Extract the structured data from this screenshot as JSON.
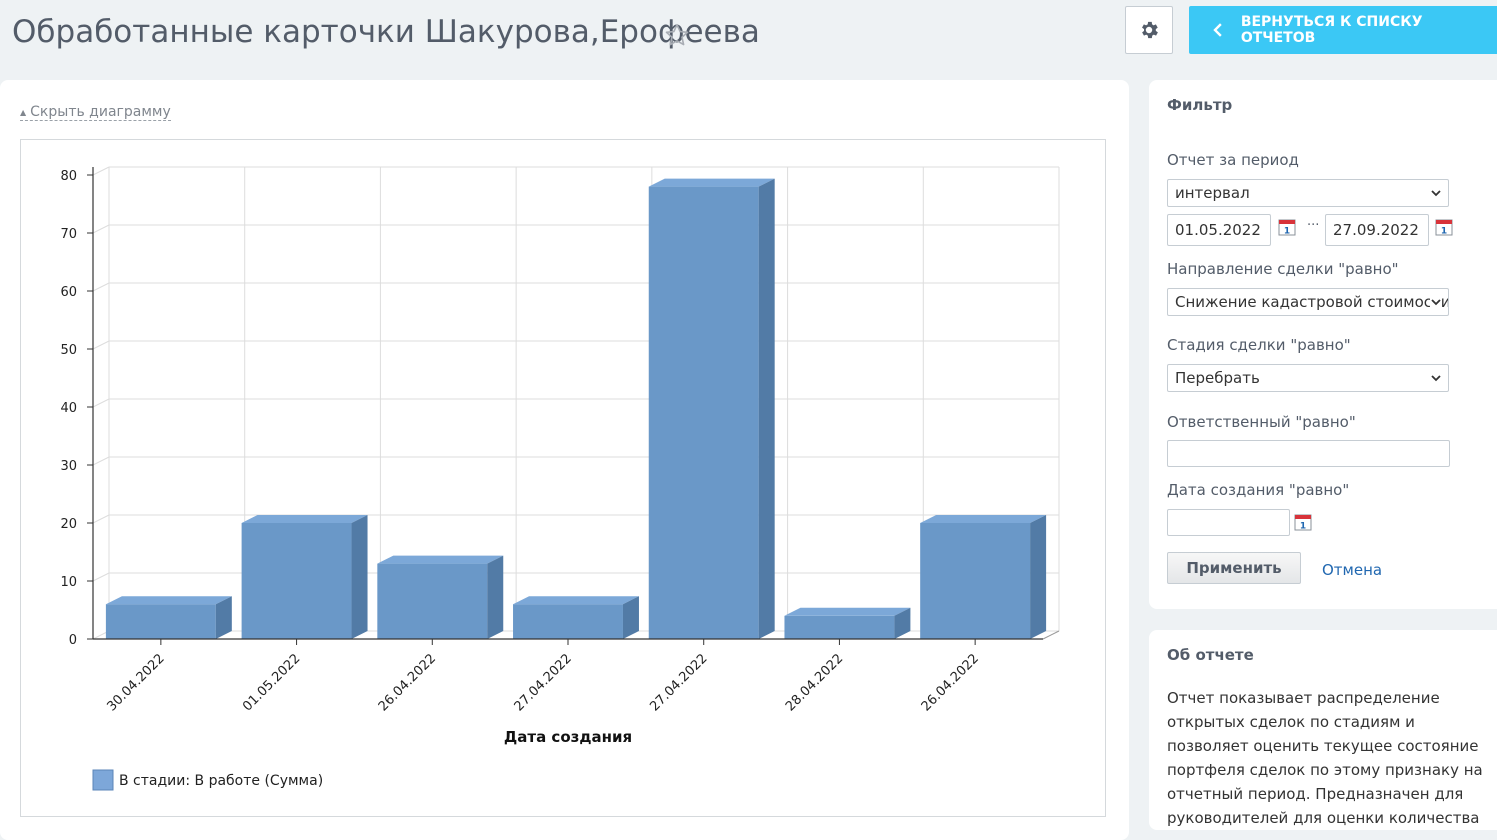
{
  "header": {
    "title": "Обработанные карточки Шакурова,Ерофеева",
    "back_label": "ВЕРНУТЬСЯ К СПИСКУ ОТЧЕТОВ"
  },
  "main": {
    "toggle_label": "Скрыть диаграмму"
  },
  "chart_data": {
    "type": "bar",
    "categories": [
      "30.04.2022",
      "01.05.2022",
      "26.04.2022",
      "27.04.2022",
      "27.04.2022",
      "28.04.2022",
      "26.04.2022"
    ],
    "series": [
      {
        "name": "В стадии: В работе (Сумма)",
        "values": [
          6,
          20,
          13,
          6,
          78,
          4,
          20
        ]
      }
    ],
    "xlabel": "Дата создания",
    "ylabel": "",
    "ylim": [
      0,
      80
    ],
    "yticks": [
      0,
      10,
      20,
      30,
      40,
      50,
      60,
      70,
      80
    ],
    "grid": true,
    "legend_position": "bottom-left",
    "style": "3d",
    "colors": {
      "bar_front": "#6a98c8",
      "bar_top": "#7ca8d8",
      "bar_side": "#527ba6",
      "grid": "#dddddd"
    }
  },
  "filter": {
    "title": "Фильтр",
    "period_label": "Отчет за период",
    "period_value": "интервал",
    "date_from": "01.05.2022",
    "date_separator": "...",
    "date_to": "27.09.2022",
    "direction_label": "Направление сделки \"равно\"",
    "direction_value": "Снижение кадастровой стоимости",
    "stage_label": "Стадия сделки \"равно\"",
    "stage_value": "Перебрать",
    "responsible_label": "Ответственный \"равно\"",
    "responsible_value": "",
    "created_label": "Дата создания \"равно\"",
    "created_value": "",
    "apply_label": "Применить",
    "cancel_label": "Отмена",
    "calendar_icon_text": "1"
  },
  "about": {
    "title": "Об отчете",
    "text": "Отчет показывает распределение открытых сделок по стадиям и позволяет оценить текущее состояние портфеля сделок по этому признаку на отчетный период. Предназначен для руководителей для оценки количества и"
  }
}
